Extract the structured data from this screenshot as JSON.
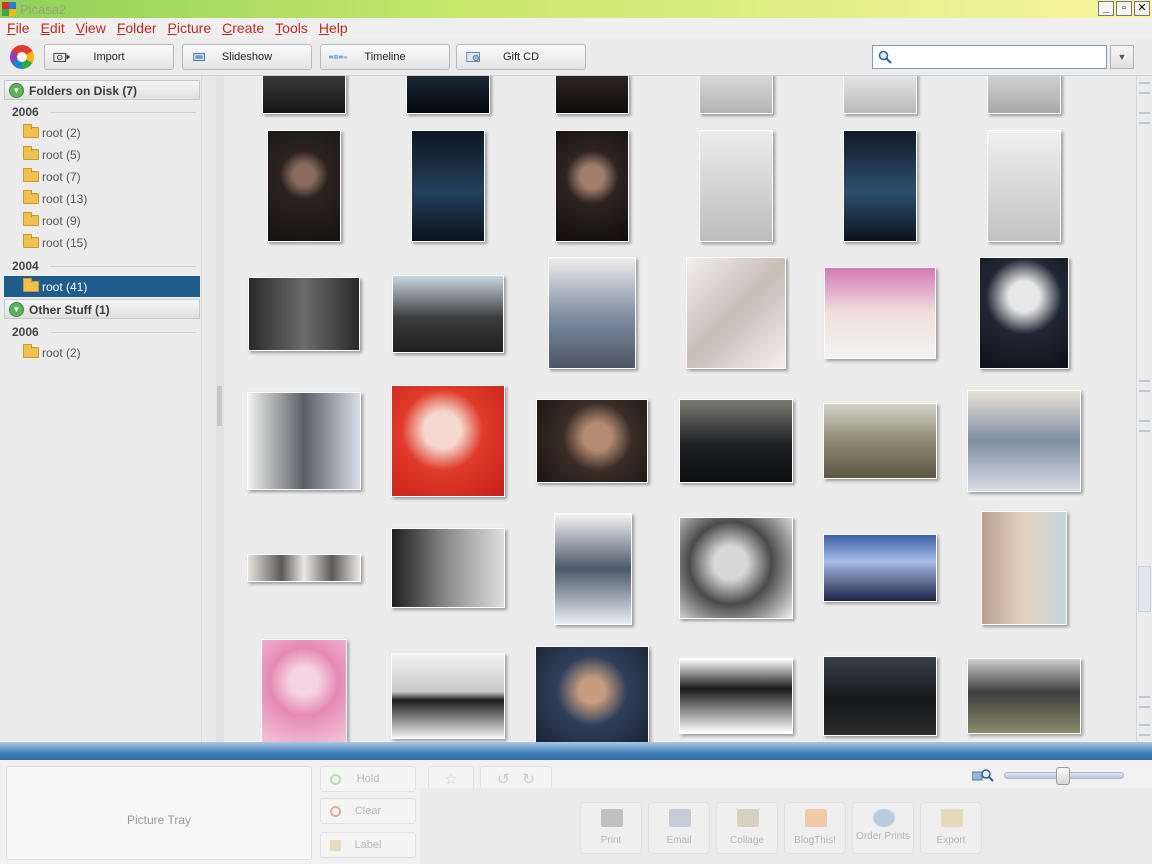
{
  "window": {
    "title": "Picasa2"
  },
  "menu": [
    {
      "label": "File"
    },
    {
      "label": "Edit"
    },
    {
      "label": "View"
    },
    {
      "label": "Folder"
    },
    {
      "label": "Picture"
    },
    {
      "label": "Create"
    },
    {
      "label": "Tools"
    },
    {
      "label": "Help"
    }
  ],
  "toolbar": {
    "import_label": "Import",
    "slideshow_label": "Slideshow",
    "timeline_label": "Timeline",
    "giftcd_label": "Gift CD",
    "search_value": ""
  },
  "sidebar": {
    "groups": [
      {
        "title": "Folders on Disk (7)"
      },
      {
        "title": "Other Stuff (1)"
      }
    ],
    "years": [
      "2006",
      "2004",
      "2006"
    ],
    "folders": [
      {
        "label": "root (2)"
      },
      {
        "label": "root (5)"
      },
      {
        "label": "root (7)"
      },
      {
        "label": "root (13)"
      },
      {
        "label": "root (9)"
      },
      {
        "label": "root (15)"
      },
      {
        "label": "root (41)",
        "selected": true
      },
      {
        "label": "root (2)"
      }
    ]
  },
  "tray": {
    "label": "Picture Tray",
    "hold_label": "Hold",
    "clear_label": "Clear",
    "label_label": "Label"
  },
  "actions": [
    {
      "label": "Print",
      "icon": "printer-icon"
    },
    {
      "label": "Email",
      "icon": "email-icon"
    },
    {
      "label": "Collage",
      "icon": "collage-icon"
    },
    {
      "label": "BlogThis!",
      "icon": "blogger-icon"
    },
    {
      "label": "Order Prints",
      "icon": "order-prints-icon"
    },
    {
      "label": "Export",
      "icon": "export-icon"
    }
  ],
  "colors": {
    "menu_text": "#c0281c",
    "selection": "#1e5c8c",
    "blue_bar": "#3f7fb8"
  }
}
